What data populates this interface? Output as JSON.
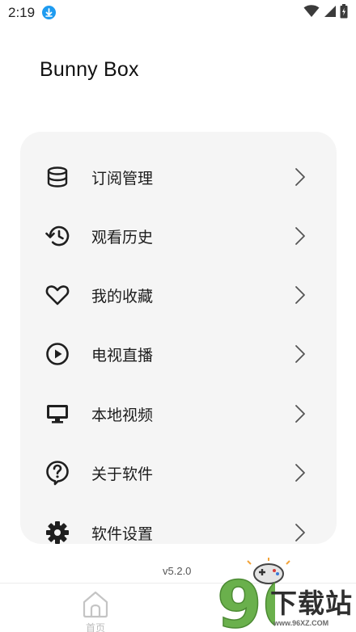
{
  "status_bar": {
    "time": "2:19"
  },
  "app": {
    "title": "Bunny Box"
  },
  "menu": {
    "items": [
      {
        "label": "订阅管理",
        "icon": "database-icon"
      },
      {
        "label": "观看历史",
        "icon": "history-icon"
      },
      {
        "label": "我的收藏",
        "icon": "heart-icon"
      },
      {
        "label": "电视直播",
        "icon": "play-circle-icon"
      },
      {
        "label": "本地视频",
        "icon": "monitor-icon"
      },
      {
        "label": "关于软件",
        "icon": "help-circle-icon"
      },
      {
        "label": "软件设置",
        "icon": "gear-icon"
      }
    ]
  },
  "version": "v5.2.0",
  "bottom_nav": {
    "home_label": "首页"
  },
  "watermark": {
    "text": "下载站",
    "number": "96",
    "site": "www.96XZ.COM"
  },
  "colors": {
    "card_background": "#f5f5f5",
    "download_badge": "#1e9bf0",
    "nav_inactive": "#bcbcbc"
  }
}
